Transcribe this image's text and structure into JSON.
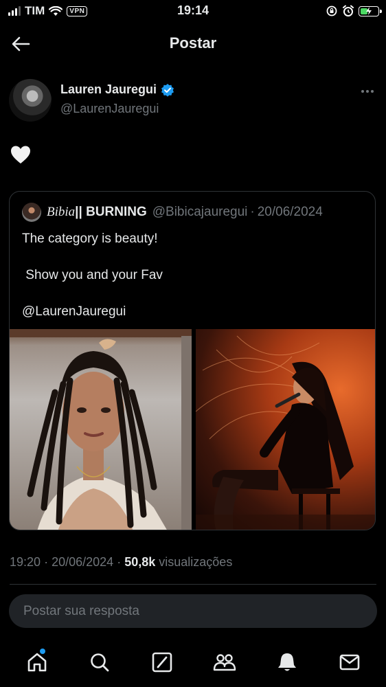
{
  "status_bar": {
    "carrier": "TIM",
    "vpn": "VPN",
    "time": "19:14"
  },
  "header": {
    "title": "Postar"
  },
  "author": {
    "name": "Lauren Jauregui",
    "handle": "@LaurenJauregui",
    "verified": true
  },
  "content": {
    "text_icon": "white-heart-icon"
  },
  "quote": {
    "name_script": "Bibia",
    "name_rest": "|| BURNING",
    "handle": "@Bibicajauregui",
    "separator": "·",
    "date": "20/06/2024",
    "lines": [
      "The category is beauty!",
      " Show you and your Fav",
      "@LaurenJauregui"
    ]
  },
  "tweet_info": {
    "time": "19:20",
    "sep1": "·",
    "date": "20/06/2024",
    "sep2": "·",
    "views_count": "50,8k",
    "views_label": "visualizações"
  },
  "reply": {
    "placeholder": "Postar sua resposta"
  },
  "bottom_nav": {
    "items": [
      "home-icon",
      "search-icon",
      "grok-icon",
      "communities-icon",
      "notifications-icon",
      "messages-icon"
    ]
  },
  "colors": {
    "background": "#000000",
    "text": "#e7e9ea",
    "muted": "#71767b",
    "accent": "#1d9bf0",
    "battery": "#4cd964"
  }
}
